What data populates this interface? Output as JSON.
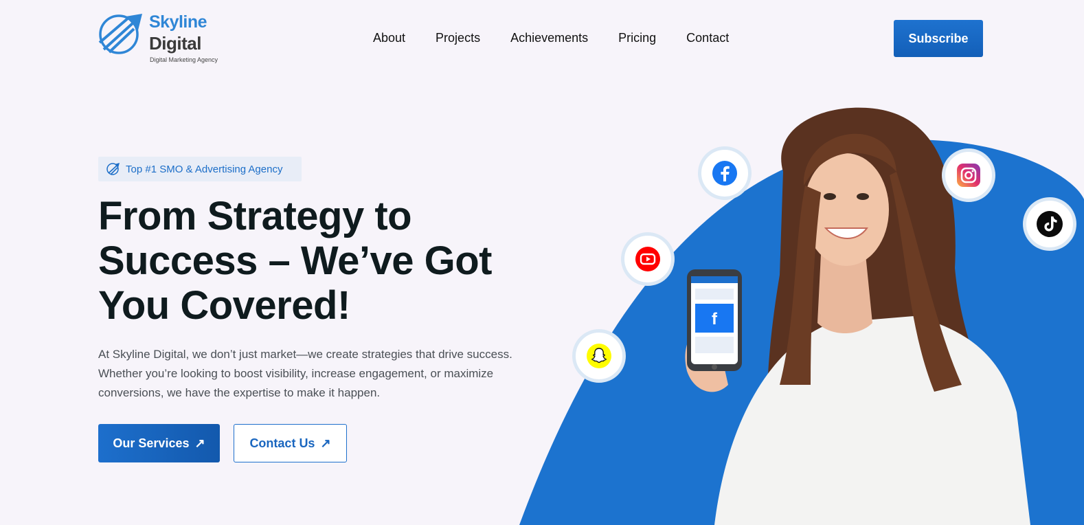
{
  "header": {
    "logo": {
      "name_line1": "Skyline",
      "name_line2": "Digital",
      "tagline": "Digital Marketing Agency"
    },
    "nav": [
      {
        "label": "About"
      },
      {
        "label": "Projects"
      },
      {
        "label": "Achievements"
      },
      {
        "label": "Pricing"
      },
      {
        "label": "Contact"
      }
    ],
    "subscribe_label": "Subscribe"
  },
  "hero": {
    "badge": "Top #1 SMO & Advertising Agency",
    "headline": "From Strategy to Success – We’ve Got You Covered!",
    "lead": "At Skyline Digital, we don’t just market—we create strategies that drive success. Whether you’re looking to boost visibility, increase engagement, or maximize conversions, we have the expertise to make it happen.",
    "primary_button": "Our Services",
    "secondary_button": "Contact Us"
  },
  "visual": {
    "social_icons": [
      "facebook-icon",
      "instagram-icon",
      "tiktok-icon",
      "youtube-icon",
      "snapchat-icon"
    ],
    "colors": {
      "accent": "#1c73cf",
      "ring": "#dbe8f5"
    }
  }
}
